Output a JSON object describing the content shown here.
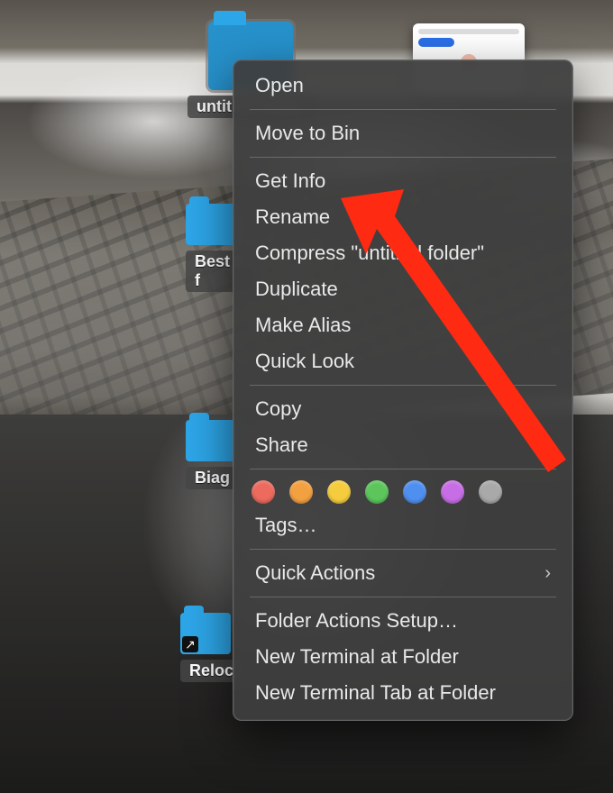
{
  "selected_folder": {
    "label": "untitled folder"
  },
  "background_icons": {
    "bests": "Best S",
    "bests_line2": "f",
    "biag": "Biag",
    "reloc": "Reloc"
  },
  "menu": {
    "open": "Open",
    "move_to_bin": "Move to Bin",
    "get_info": "Get Info",
    "rename": "Rename",
    "compress": "Compress \"untitled folder\"",
    "duplicate": "Duplicate",
    "make_alias": "Make Alias",
    "quick_look": "Quick Look",
    "copy": "Copy",
    "share": "Share",
    "tags": "Tags…",
    "quick_actions": "Quick Actions",
    "folder_actions_setup": "Folder Actions Setup…",
    "new_terminal_at_folder": "New Terminal at Folder",
    "new_terminal_tab_at_folder": "New Terminal Tab at Folder"
  },
  "tag_colors": {
    "red": "#ec6a5e",
    "orange": "#f3a041",
    "yellow": "#f5cc3e",
    "green": "#5cc65c",
    "blue": "#4f8ff0",
    "purple": "#c76ee6",
    "gray": "#a9a9a9"
  },
  "annotation": {
    "target": "Get Info",
    "color": "#ff2a12"
  }
}
